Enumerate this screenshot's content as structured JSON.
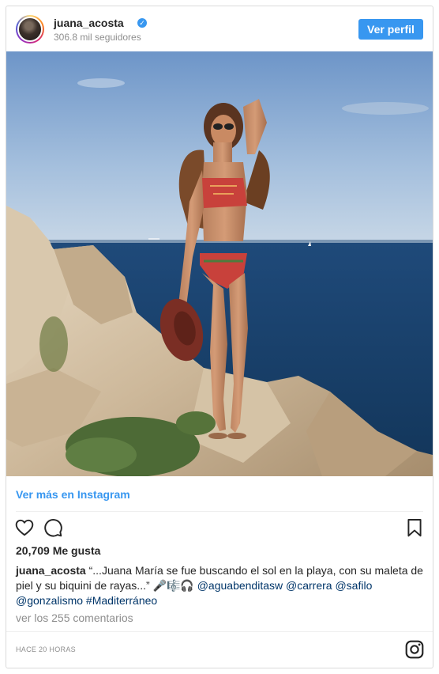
{
  "header": {
    "username": "juana_acosta",
    "followers": "306.8 mil seguidores",
    "profile_button": "Ver perfil"
  },
  "icons": {
    "verified": "verified-badge-icon",
    "like": "heart-icon",
    "comment": "comment-icon",
    "save": "bookmark-icon",
    "brand": "instagram-icon"
  },
  "photo": {
    "alt": ""
  },
  "post": {
    "more_link": "Ver más en Instagram",
    "likes": "20,709 Me gusta",
    "caption_user": "juana_acosta",
    "caption_text": " “...Juana María se fue buscando el sol en la playa, con su maleta de piel y su biquini de rayas...” 🎤🎼🎧 ",
    "tags": [
      "@aguabenditasw",
      "@carrera",
      "@safilo",
      "@gonzalismo",
      "#Maditerráneo"
    ],
    "comments": "ver los 255 comentarios",
    "time": "HACE 20 HORAS"
  },
  "colors": {
    "accent": "#3897f0",
    "tag": "#003569",
    "muted": "#8e8e8e"
  }
}
